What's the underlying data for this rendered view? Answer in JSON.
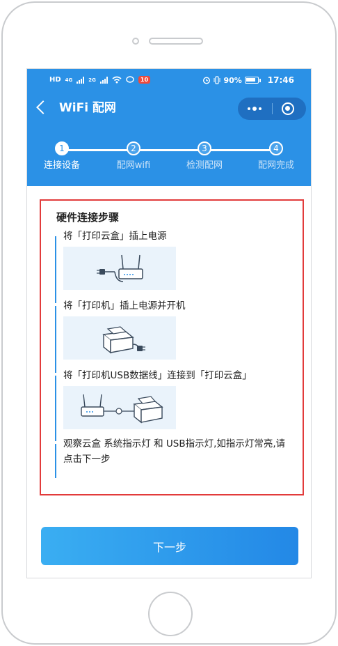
{
  "statusbar": {
    "left_items": [
      "HD",
      "4G",
      "2G"
    ],
    "notification_badge": "10",
    "battery_percent": "90%",
    "time": "17:46"
  },
  "navbar": {
    "title": "WiFi 配网",
    "back_icon": "chevron-left-icon",
    "more_icon": "more-dots-icon",
    "close_icon": "close-target-icon"
  },
  "stepper": {
    "current_step": 1,
    "steps": [
      {
        "number": "1",
        "label": "连接设备"
      },
      {
        "number": "2",
        "label": "配网wifi"
      },
      {
        "number": "3",
        "label": "检测配网"
      },
      {
        "number": "4",
        "label": "配网完成"
      }
    ]
  },
  "hardware": {
    "title": "硬件连接步骤",
    "steps": [
      {
        "text": "将「打印云盒」插上电源",
        "image": "router-plug-icon"
      },
      {
        "text": "将「打印机」插上电源并开机",
        "image": "printer-plug-icon"
      },
      {
        "text": "将「打印机USB数据线」连接到「打印云盒」",
        "image": "router-printer-usb-icon"
      },
      {
        "text": "观察云盒 系统指示灯 和 USB指示灯,如指示灯常亮,请点击下一步",
        "image": ""
      }
    ]
  },
  "next_button": "下一步",
  "colors": {
    "primary": "#2b91e6",
    "highlight_border": "#e23b3b",
    "button_gradient_start": "#3aaef2",
    "button_gradient_end": "#2388e6"
  }
}
